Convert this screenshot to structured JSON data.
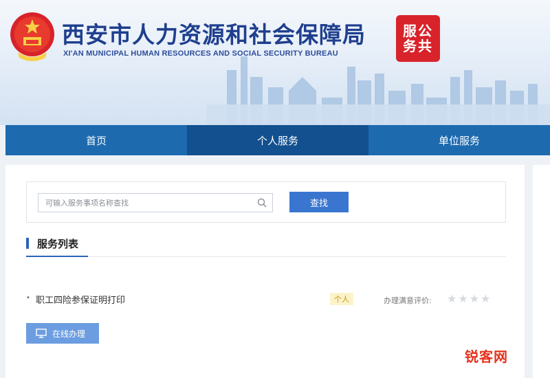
{
  "header": {
    "title_cn": "西安市人力资源和社会保障局",
    "title_en": "XI'AN MUNICIPAL HUMAN RESOURCES AND SOCIAL SECURITY BUREAU",
    "seal_text": "服公务共"
  },
  "nav": {
    "items": [
      {
        "label": "首页",
        "active": false
      },
      {
        "label": "个人服务",
        "active": true
      },
      {
        "label": "单位服务",
        "active": false
      }
    ]
  },
  "search": {
    "placeholder": "可输入服务事项名称查找",
    "value": "",
    "button_label": "查找"
  },
  "section": {
    "title": "服务列表"
  },
  "services": [
    {
      "name": "职工四险参保证明打印",
      "tag": "个人",
      "rating_label": "办理满意评价:",
      "rating_stars": 0,
      "rating_max": 5,
      "stars_text": "★★★★"
    }
  ],
  "actions": {
    "handle_label": "在线办理"
  },
  "watermark": "锐客网",
  "colors": {
    "nav_bg": "#1d6aaf",
    "nav_active": "#12508f",
    "primary_button": "#3a76cf",
    "handle_button": "#6c9de0",
    "seal": "#d8232a",
    "title": "#1f3f8e"
  }
}
